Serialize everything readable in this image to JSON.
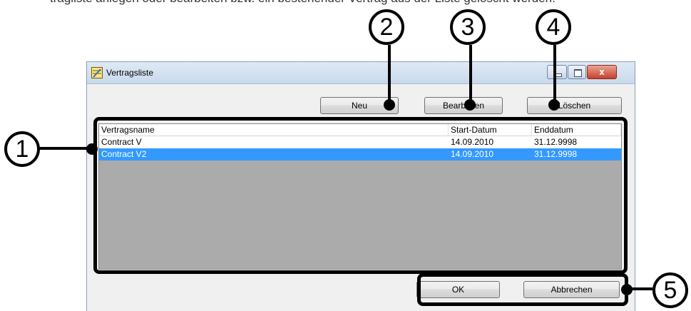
{
  "caption": "tragliste anlegen oder bearbeiten bzw. ein bestehender Vertrag aus der Liste gelöscht werden.",
  "window": {
    "title": "Vertragsliste",
    "close_label": "x"
  },
  "toolbar": {
    "new_label": "Neu",
    "edit_label": "Bearbeiten",
    "delete_label": "Löschen"
  },
  "list": {
    "columns": [
      "Vertragsname",
      "Start-Datum",
      "Enddatum"
    ],
    "rows": [
      {
        "name": "Contract V",
        "start": "14.09.2010",
        "end": "31.12.9998",
        "selected": false
      },
      {
        "name": "Contract V2",
        "start": "14.09.2010",
        "end": "31.12.9998",
        "selected": true
      }
    ]
  },
  "footer": {
    "ok_label": "OK",
    "cancel_label": "Abbrechen"
  },
  "callouts": [
    "1",
    "2",
    "3",
    "4",
    "5"
  ],
  "colors": {
    "selection": "#3399ff",
    "list_background": "#ababab"
  }
}
